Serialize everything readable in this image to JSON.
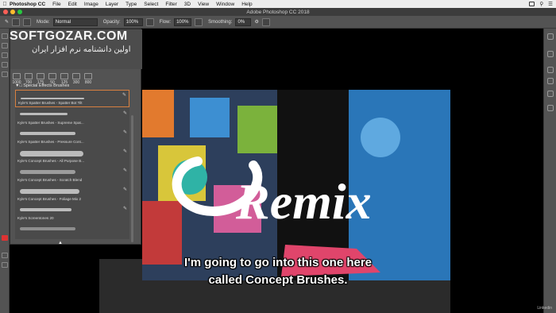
{
  "menubar": {
    "app": "Photoshop CC",
    "items": [
      "File",
      "Edit",
      "Image",
      "Layer",
      "Type",
      "Select",
      "Filter",
      "3D",
      "View",
      "Window",
      "Help"
    ]
  },
  "window": {
    "title": "Adobe Photoshop CC 2018"
  },
  "options": {
    "mode_label": "Mode:",
    "mode_value": "Normal",
    "opacity_label": "Opacity:",
    "opacity_value": "100%",
    "flow_label": "Flow:",
    "flow_value": "100%",
    "smoothing_label": "Smoothing:",
    "smoothing_value": "0%",
    "brush_size": "1000"
  },
  "watermark": {
    "text": "SOFTGOZAR.COM",
    "subtitle": "اولین دانشنامه نرم افزار ایران"
  },
  "brushes_panel": {
    "sizes": [
      "1000",
      "700",
      "175",
      "50",
      "125",
      "300",
      "800"
    ],
    "folder": "Special Effects Brushes",
    "brushes": [
      {
        "name": "Kyle's Spatter Brushes - Spatter Bot Tilt"
      },
      {
        "name": "Kyle's Spatter Brushes - Supreme Spat..."
      },
      {
        "name": "Kyle's Spatter Brushes - Pressure Cont..."
      },
      {
        "name": "Kyle's Concept Brushes - All Purpose B..."
      },
      {
        "name": "Kyle's Concept Brushes - Scratch Blend"
      },
      {
        "name": "Kyle's Concept Brushes - Foliage Mix 2"
      },
      {
        "name": "Kyle's Screentones 20"
      }
    ]
  },
  "artwork": {
    "text": "Remix"
  },
  "subtitles": [
    "I'm going to go into this one here",
    "called Concept Brushes."
  ],
  "brand": "Linkedin",
  "colors": {
    "menubar": "#ececec",
    "chrome": "#535353",
    "selected_brush": "#d88040"
  }
}
